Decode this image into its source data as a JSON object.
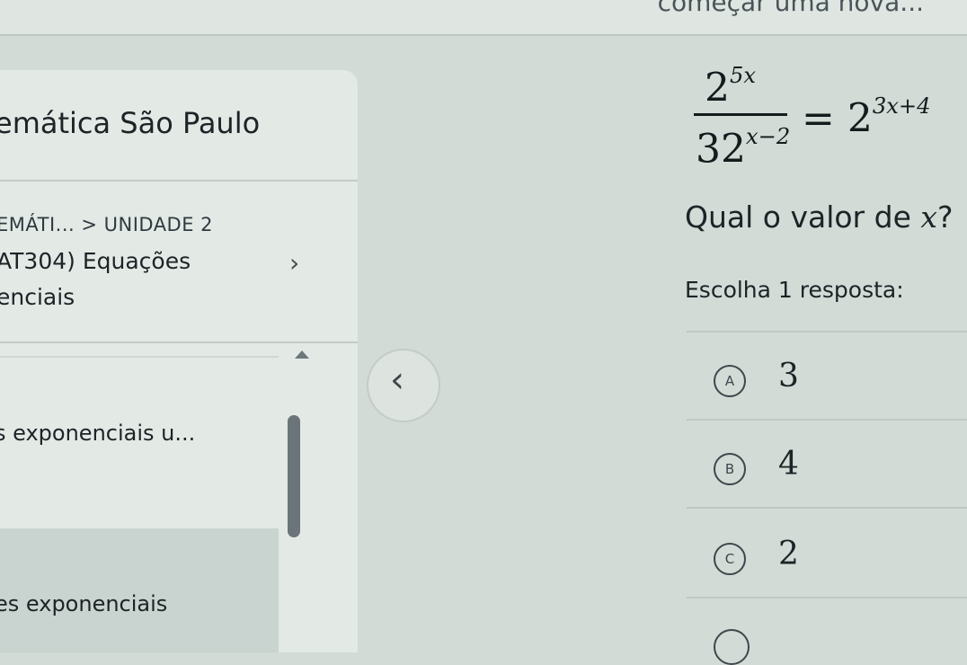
{
  "top_strip": {
    "text": "começar uma nova..."
  },
  "sidebar": {
    "course_title": "emática São Paulo",
    "breadcrumb": "EMÁTI... > UNIDADE 2",
    "lesson_title_line1": "AT304) Equações",
    "lesson_title_line2": "enciais",
    "items": [
      {
        "label": "s exponenciais u..."
      },
      {
        "label": "es exponenciais"
      }
    ]
  },
  "question": {
    "formula": {
      "numerator_base": "2",
      "numerator_exp": "5x",
      "denominator_base": "32",
      "denominator_exp": "x−2",
      "equals": "=",
      "rhs_base": "2",
      "rhs_exp": "3x+4"
    },
    "prompt": "Qual o valor de ",
    "prompt_var": "x",
    "prompt_end": "?",
    "instruction": "Escolha 1 resposta:",
    "options": [
      {
        "letter": "A",
        "value": "3"
      },
      {
        "letter": "B",
        "value": "4"
      },
      {
        "letter": "C",
        "value": "2"
      }
    ]
  },
  "icons": {
    "chevron_right": "›",
    "chevron_left": "‹"
  }
}
